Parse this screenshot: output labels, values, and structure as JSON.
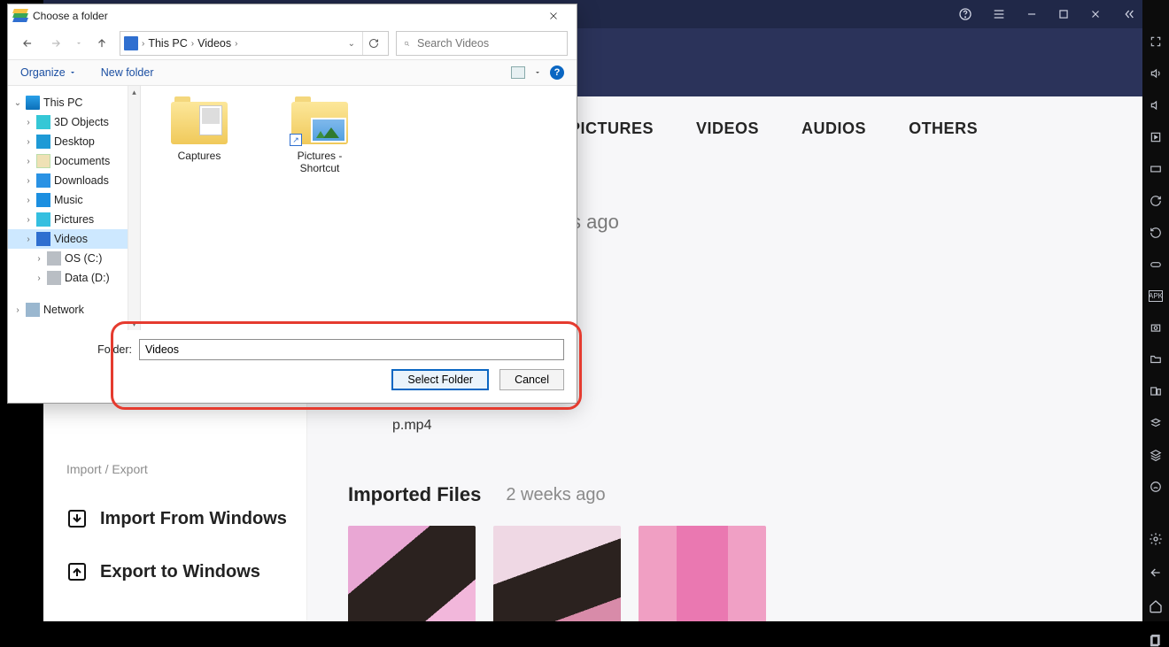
{
  "bg": {
    "tabs": [
      "PICTURES",
      "VIDEOS",
      "AUDIOS",
      "OTHERS"
    ],
    "time1": "s ago",
    "pmp": "p.mp4",
    "imported_heading": "Imported Files",
    "imported_time": "2 weeks ago"
  },
  "sidebar": {
    "tiny": "Import / Export",
    "import_label": "Import From Windows",
    "export_label": "Export to Windows"
  },
  "dialog": {
    "title": "Choose a folder",
    "breadcrumb": {
      "pc": "This PC",
      "videos": "Videos"
    },
    "search_placeholder": "Search Videos",
    "organize": "Organize",
    "new_folder": "New folder",
    "help": "?",
    "tree": {
      "this_pc": "This PC",
      "items": [
        "3D Objects",
        "Desktop",
        "Documents",
        "Downloads",
        "Music",
        "Pictures",
        "Videos",
        "OS (C:)",
        "Data (D:)"
      ],
      "network": "Network"
    },
    "folders": {
      "captures": "Captures",
      "pictures_shortcut_l1": "Pictures -",
      "pictures_shortcut_l2": "Shortcut"
    },
    "footer": {
      "label": "Folder:",
      "value": "Videos",
      "select": "Select Folder",
      "cancel": "Cancel"
    }
  }
}
